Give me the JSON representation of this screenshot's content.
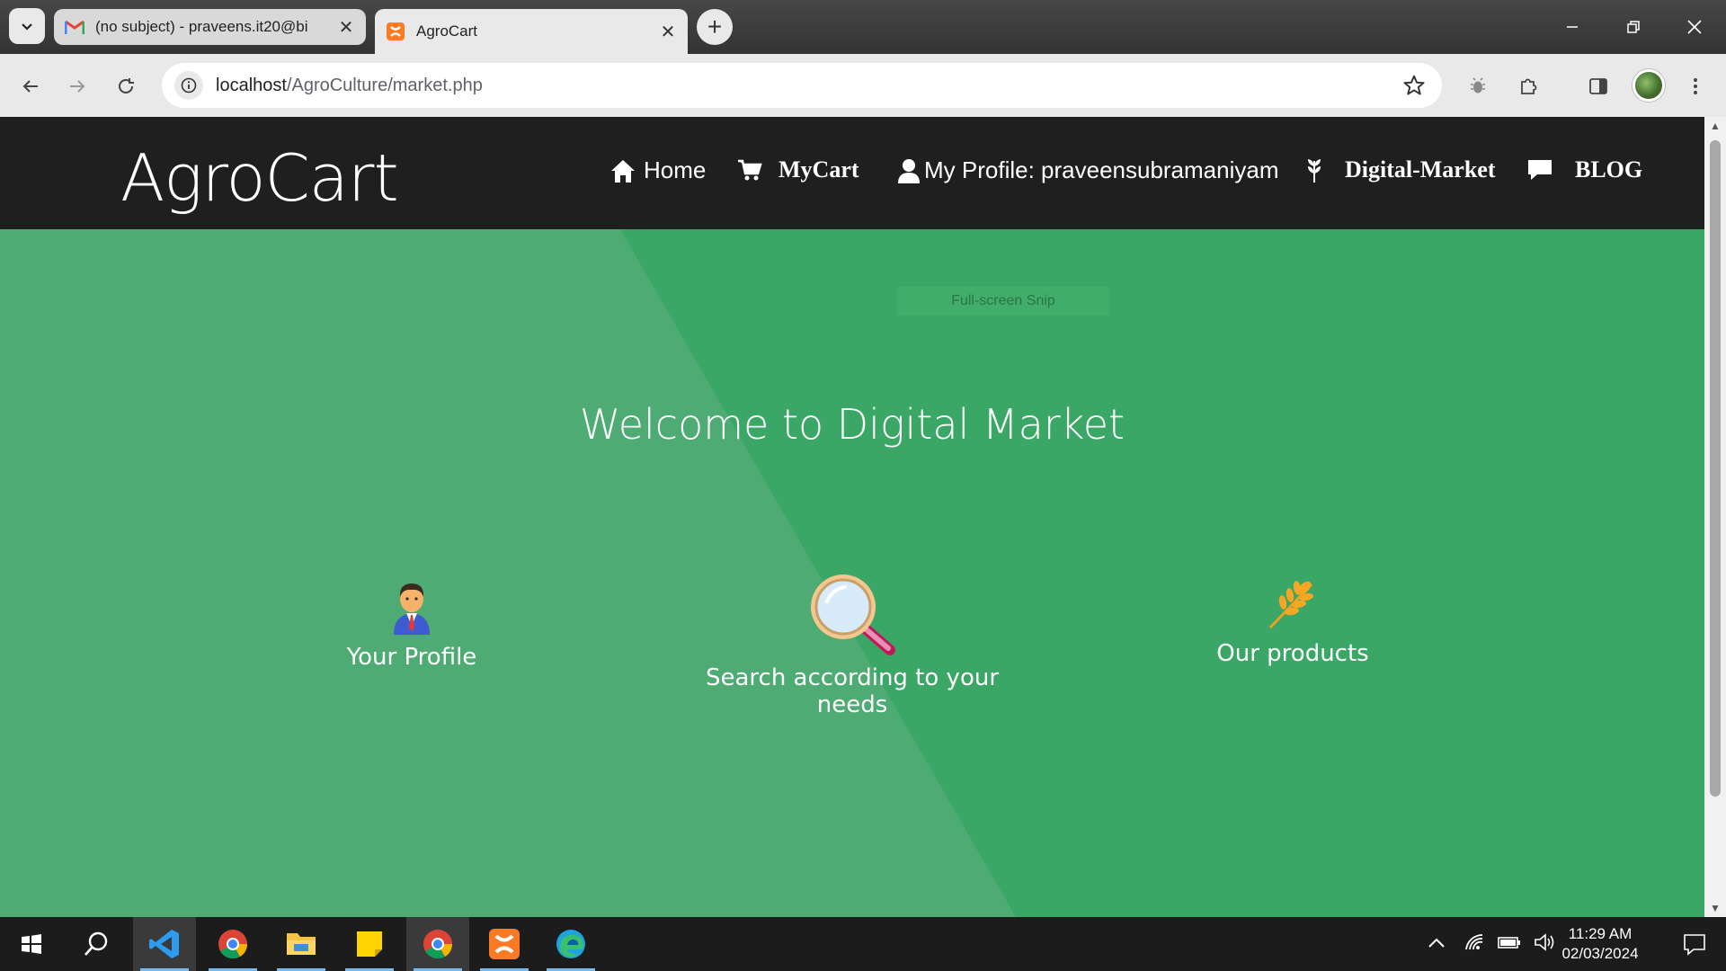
{
  "browser": {
    "tabs": [
      {
        "title": "(no subject) - praveens.it20@bi",
        "favicon": "gmail-icon",
        "active": false
      },
      {
        "title": "AgroCart",
        "favicon": "xampp-icon",
        "active": true
      }
    ],
    "url_host": "localhost",
    "url_path": "/AgroCulture/market.php"
  },
  "site": {
    "brand": "AgroCart",
    "nav": {
      "home": "Home",
      "cart": "MyCart",
      "profile": "My Profile: praveensubramaniyam",
      "market": "Digital-Market",
      "blog": "BLOG"
    },
    "snip_overlay": "Full-screen Snip",
    "welcome": "Welcome to Digital Market",
    "features": {
      "profile": "Your Profile",
      "search": "Search according to your needs",
      "products": "Our products"
    }
  },
  "taskbar": {
    "time": "11:29 AM",
    "date": "02/03/2024"
  },
  "colors": {
    "header_bg": "#1f1f1f",
    "hero_left": "#4dab73",
    "hero_right": "#3ba766"
  }
}
